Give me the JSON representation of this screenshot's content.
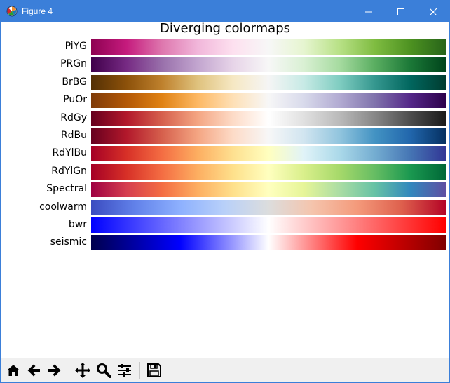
{
  "window": {
    "title": "Figure 4"
  },
  "figure": {
    "title": "Diverging colormaps"
  },
  "colormaps": [
    {
      "name": "PiYG",
      "stops": [
        "#8e0152",
        "#c51b7d",
        "#de77ae",
        "#f1b6da",
        "#fde0ef",
        "#f7f7f7",
        "#e6f5d0",
        "#b8e186",
        "#7fbc41",
        "#4d9221",
        "#276419"
      ]
    },
    {
      "name": "PRGn",
      "stops": [
        "#40004b",
        "#762a83",
        "#9970ab",
        "#c2a5cf",
        "#e7d4e8",
        "#f7f7f7",
        "#d9f0d3",
        "#a6dba0",
        "#5aae61",
        "#1b7837",
        "#00441b"
      ]
    },
    {
      "name": "BrBG",
      "stops": [
        "#543005",
        "#8c510a",
        "#bf812d",
        "#dfc27d",
        "#f6e8c3",
        "#f5f5f5",
        "#c7eae5",
        "#80cdc1",
        "#35978f",
        "#01665e",
        "#003c30"
      ]
    },
    {
      "name": "PuOr",
      "stops": [
        "#7f3b08",
        "#b35806",
        "#e08214",
        "#fdb863",
        "#fee0b6",
        "#f7f7f7",
        "#d8daeb",
        "#b2abd2",
        "#8073ac",
        "#542788",
        "#2d004b"
      ]
    },
    {
      "name": "RdGy",
      "stops": [
        "#67001f",
        "#b2182b",
        "#d6604d",
        "#f4a582",
        "#fddbc7",
        "#ffffff",
        "#e0e0e0",
        "#bababa",
        "#878787",
        "#4d4d4d",
        "#1a1a1a"
      ]
    },
    {
      "name": "RdBu",
      "stops": [
        "#67001f",
        "#b2182b",
        "#d6604d",
        "#f4a582",
        "#fddbc7",
        "#f7f7f7",
        "#d1e5f0",
        "#92c5de",
        "#4393c3",
        "#2166ac",
        "#053061"
      ]
    },
    {
      "name": "RdYlBu",
      "stops": [
        "#a50026",
        "#d73027",
        "#f46d43",
        "#fdae61",
        "#fee090",
        "#ffffbf",
        "#e0f3f8",
        "#abd9e9",
        "#74add1",
        "#4575b4",
        "#313695"
      ]
    },
    {
      "name": "RdYlGn",
      "stops": [
        "#a50026",
        "#d73027",
        "#f46d43",
        "#fdae61",
        "#fee08b",
        "#ffffbf",
        "#d9ef8b",
        "#a6d96a",
        "#66bd63",
        "#1a9850",
        "#006837"
      ]
    },
    {
      "name": "Spectral",
      "stops": [
        "#9e0142",
        "#d53e4f",
        "#f46d43",
        "#fdae61",
        "#fee08b",
        "#ffffbf",
        "#e6f598",
        "#abdda4",
        "#66c2a5",
        "#3288bd",
        "#5e4fa2"
      ]
    },
    {
      "name": "coolwarm",
      "stops": [
        "#3b4cc0",
        "#6282ea",
        "#8db0fe",
        "#b8d0f9",
        "#dcdddd",
        "#f5c4ac",
        "#f49a7b",
        "#de604d",
        "#b40426"
      ]
    },
    {
      "name": "bwr",
      "stops": [
        "#0000ff",
        "#ffffff",
        "#ff0000"
      ]
    },
    {
      "name": "seismic",
      "stops": [
        "#00004d",
        "#0000ff",
        "#ffffff",
        "#ff0000",
        "#800000"
      ]
    }
  ],
  "toolbar": {
    "buttons": [
      {
        "name": "home-icon",
        "tip": "Home"
      },
      {
        "name": "back-arrow-icon",
        "tip": "Back"
      },
      {
        "name": "forward-arrow-icon",
        "tip": "Forward"
      },
      {
        "name": "pan-icon",
        "tip": "Pan"
      },
      {
        "name": "zoom-icon",
        "tip": "Zoom"
      },
      {
        "name": "subplots-icon",
        "tip": "Subplots"
      },
      {
        "name": "save-icon",
        "tip": "Save"
      }
    ]
  }
}
